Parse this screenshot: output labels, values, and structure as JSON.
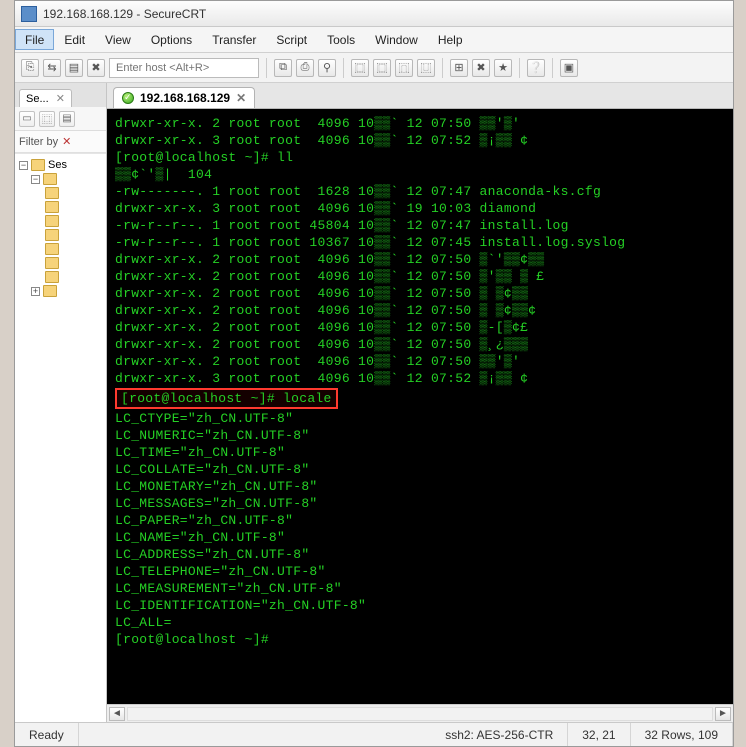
{
  "title": "192.168.168.129 - SecureCRT",
  "menu": [
    "File",
    "Edit",
    "View",
    "Options",
    "Transfer",
    "Script",
    "Tools",
    "Window",
    "Help"
  ],
  "menu_selected_index": 0,
  "host_placeholder": "Enter host <Alt+R>",
  "sidebar": {
    "tab_label": "Se...",
    "filter_label": "Filter by",
    "tree_root": "Ses"
  },
  "session_tab": {
    "label": "192.168.168.129"
  },
  "terminal_lines": [
    "drwxr-xr-x. 2 root root  4096 10▒▒` 12 07:50 ▒▒'▒'",
    "drwxr-xr-x. 3 root root  4096 10▒▒` 12 07:52 ▒¡▒▒ ¢",
    "[root@localhost ~]# ll",
    "▒▒¢`'▒|  104",
    "-rw-------. 1 root root  1628 10▒▒` 12 07:47 anaconda-ks.cfg",
    "drwxr-xr-x. 3 root root  4096 10▒▒` 19 10:03 diamond",
    "-rw-r--r--. 1 root root 45804 10▒▒` 12 07:47 install.log",
    "-rw-r--r--. 1 root root 10367 10▒▒` 12 07:45 install.log.syslog",
    "drwxr-xr-x. 2 root root  4096 10▒▒` 12 07:50 ▒`'▒▒¢▒▒",
    "drwxr-xr-x. 2 root root  4096 10▒▒` 12 07:50 ▒'▒▒ ▒ £",
    "drwxr-xr-x. 2 root root  4096 10▒▒` 12 07:50 ▒ ▒¢▒▒",
    "drwxr-xr-x. 2 root root  4096 10▒▒` 12 07:50 ▒ ▒¢▒▒¢",
    "drwxr-xr-x. 2 root root  4096 10▒▒` 12 07:50 ▒-[▒¢£",
    "drwxr-xr-x. 2 root root  4096 10▒▒` 12 07:50 ▒¸¿▒▒▒",
    "drwxr-xr-x. 2 root root  4096 10▒▒` 12 07:50 ▒▒'▒'",
    "drwxr-xr-x. 3 root root  4096 10▒▒` 12 07:52 ▒¡▒▒ ¢"
  ],
  "highlight_line": "[root@localhost ~]# locale",
  "locale_lines": [
    "LC_CTYPE=\"zh_CN.UTF-8\"",
    "LC_NUMERIC=\"zh_CN.UTF-8\"",
    "LC_TIME=\"zh_CN.UTF-8\"",
    "LC_COLLATE=\"zh_CN.UTF-8\"",
    "LC_MONETARY=\"zh_CN.UTF-8\"",
    "LC_MESSAGES=\"zh_CN.UTF-8\"",
    "LC_PAPER=\"zh_CN.UTF-8\"",
    "LC_NAME=\"zh_CN.UTF-8\"",
    "LC_ADDRESS=\"zh_CN.UTF-8\"",
    "LC_TELEPHONE=\"zh_CN.UTF-8\"",
    "LC_MEASUREMENT=\"zh_CN.UTF-8\"",
    "LC_IDENTIFICATION=\"zh_CN.UTF-8\"",
    "LC_ALL="
  ],
  "prompt_line": "[root@localhost ~]#",
  "status": {
    "ready": "Ready",
    "cipher": "ssh2: AES-256-CTR",
    "cursor": "32, 21",
    "size": "32 Rows, 109"
  },
  "toolbar_icons": [
    "⎘",
    "⇆",
    "▤",
    "✖",
    "",
    "",
    "⧉",
    "⎙",
    "⚲",
    "",
    "⿴",
    "⿴",
    "⿵",
    "⿶",
    "",
    "⊞",
    "✖",
    "★",
    "",
    "❔",
    "",
    "▣"
  ],
  "side_icons": [
    "▭",
    "⿴",
    "▤"
  ]
}
